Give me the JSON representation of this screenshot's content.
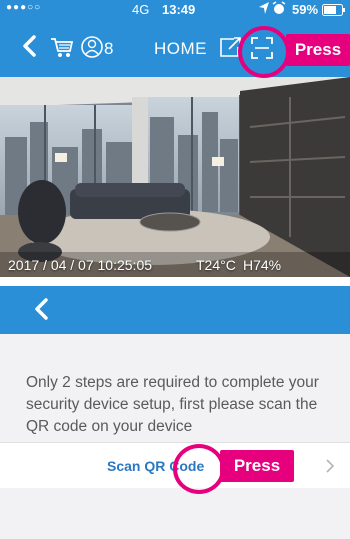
{
  "status": {
    "carrier_dots": "●●●○○",
    "network": "4G",
    "time": "13:49",
    "battery": "59%"
  },
  "home_nav": {
    "back_icon": "chevron-left-icon",
    "cart_icon": "cart-icon",
    "user_icon": "user-icon",
    "user_count": "8",
    "title": "HOME",
    "share_icon": "share-icon",
    "scan_icon": "scan-icon"
  },
  "camera": {
    "timestamp": "2017 / 04 / 07 10:25:05",
    "temperature": "T24°C",
    "humidity": "H74%"
  },
  "annotations": {
    "press_top": "Press",
    "press_bottom": "Press"
  },
  "setup": {
    "back_icon": "chevron-left-icon",
    "description": "Only 2 steps are required to complete your security device setup, first please scan the QR code on your device",
    "scan_label": "Scan QR Code",
    "arrow_icon": "chevron-right-icon"
  },
  "colors": {
    "primary": "#2a8fd6",
    "highlight": "#e6007e",
    "link": "#2a78c2"
  }
}
